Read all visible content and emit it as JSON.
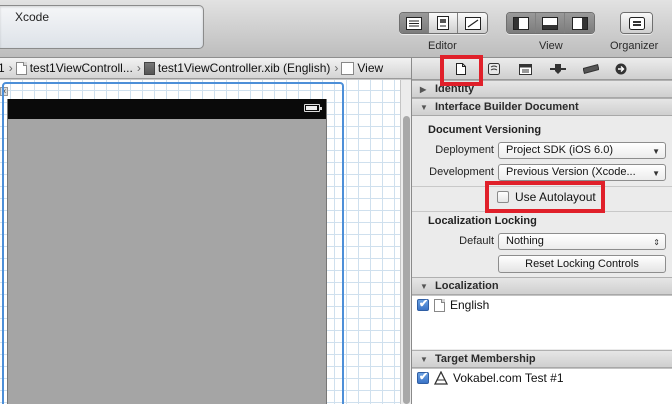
{
  "activity": {
    "title": "Xcode"
  },
  "toolbar": {
    "editor_label": "Editor",
    "view_label": "View",
    "organizer_label": "Organizer"
  },
  "jumpbar": {
    "crumbs": [
      "1",
      "test1ViewControll...",
      "test1ViewController.xib (English)",
      "View"
    ]
  },
  "inspector": {
    "identity": "Identity",
    "ib_document": "Interface Builder Document",
    "document_versioning": "Document Versioning",
    "deployment_label": "Deployment",
    "deployment_value": "Project SDK (iOS 6.0)",
    "development_label": "Development",
    "development_value": "Previous Version (Xcode...",
    "use_autolayout": "Use Autolayout",
    "use_autolayout_checked": false,
    "localization_locking": "Localization Locking",
    "default_label": "Default",
    "default_value": "Nothing",
    "reset_locking": "Reset Locking Controls",
    "localization": "Localization",
    "localization_item": "English",
    "localization_item_checked": true,
    "target_membership": "Target Membership",
    "target_item": "Vokabel.com Test #1",
    "target_item_checked": true
  },
  "colors": {
    "highlight": "#e0202a",
    "selection": "#4d8fd8"
  }
}
